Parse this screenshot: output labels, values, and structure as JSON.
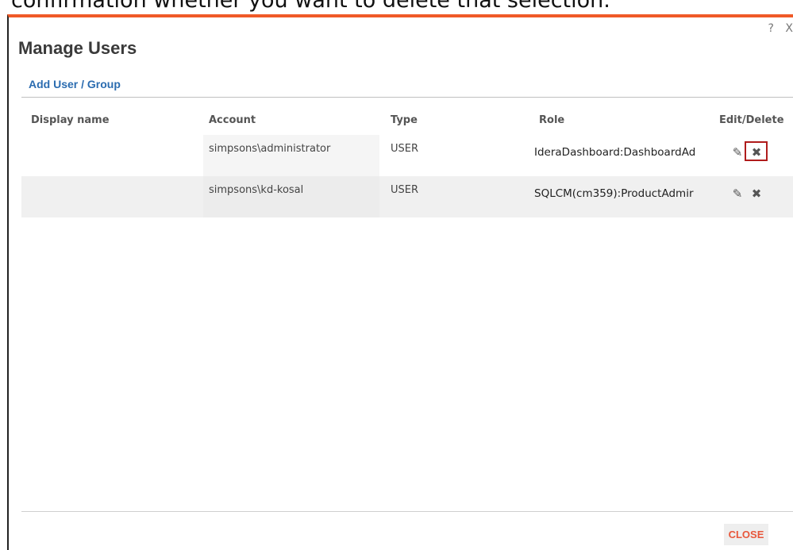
{
  "caption": "confirmation whether you want to delete that selection.",
  "dialog": {
    "title": "Manage Users",
    "help_label": "?",
    "close_x_label": "X",
    "add_link": "Add User / Group",
    "close_button": "CLOSE",
    "accent_color": "#f05a28"
  },
  "table": {
    "headers": {
      "display_name": "Display name",
      "account": "Account",
      "type": "Type",
      "role": "Role",
      "edit_delete": "Edit/Delete"
    },
    "rows": [
      {
        "display_name": "",
        "account": "simpsons\\administrator",
        "type": "USER",
        "role": "IderaDashboard:DashboardAd",
        "edit_icon": "pencil-icon",
        "delete_icon": "x-icon"
      },
      {
        "display_name": "",
        "account": "simpsons\\kd-kosal",
        "type": "USER",
        "role": "SQLCM(cm359):ProductAdmir",
        "edit_icon": "pencil-icon",
        "delete_icon": "x-icon"
      }
    ]
  },
  "icons": {
    "edit_glyph": "✎",
    "delete_glyph": "✖"
  }
}
